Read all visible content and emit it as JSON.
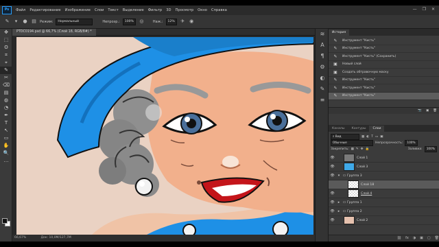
{
  "menu": {
    "logo": "Ps",
    "items": [
      "Файл",
      "Редактирование",
      "Изображение",
      "Слои",
      "Текст",
      "Выделение",
      "Фильтр",
      "3D",
      "Просмотр",
      "Окно",
      "Справка"
    ],
    "window_controls": [
      "—",
      "❐",
      "✕"
    ]
  },
  "options": {
    "mode_label": "Режим:",
    "mode_value": "Нормальный",
    "opacity_label": "Непрозр.:",
    "opacity_value": "100%",
    "pressure_label": "Наж.:",
    "pressure_value": "12%"
  },
  "tools": [
    "✥",
    "⬚",
    "ʘ",
    "⌗",
    "⌖",
    "✎",
    "✂",
    "⌫",
    "▤",
    "◍",
    "◔",
    "✒",
    "T",
    "↖",
    "▭",
    "✋",
    "🔍",
    "…"
  ],
  "document": {
    "tab_title": "PTDC0194.psd @ 66,7% (Слой 18, RGB/8#) *",
    "status_zoom": "66,67%",
    "status_doc": "Док: 10,0M/127,7M"
  },
  "iconstrip": [
    "≋",
    "A",
    "¶",
    "⚙",
    "◐",
    "✎",
    "≡"
  ],
  "history": {
    "tab": "История",
    "rows": [
      {
        "label": "Инструмент \"Кисть\"",
        "selected": false
      },
      {
        "label": "Инструмент \"Кисть\"",
        "selected": false
      },
      {
        "label": "Инструмент \"Кисть\" (Сохранить)",
        "selected": false
      },
      {
        "label": "Новый слой",
        "selected": false
      },
      {
        "label": "Создать обтравочную маску",
        "selected": false
      },
      {
        "label": "Инструмент \"Кисть\"",
        "selected": false
      },
      {
        "label": "Инструмент \"Кисть\"",
        "selected": false
      },
      {
        "label": "Инструмент \"Кисть\"",
        "selected": true
      }
    ],
    "footer_icons": [
      "📷",
      "▣",
      "🗑"
    ]
  },
  "layers": {
    "tabs": [
      "Каналы",
      "Контуры",
      "Слои"
    ],
    "active_tab": "Слои",
    "kind_label": "Вид",
    "blend_value": "Обычные",
    "opacity_label": "Непрозрачность:",
    "opacity_value": "100%",
    "lock_label": "Закрепить:",
    "fill_label": "Заливка:",
    "fill_value": "100%",
    "rows": [
      {
        "name": "Слой 1",
        "indent": 1,
        "thumb": "#7a7a7a",
        "selected": false,
        "group": false
      },
      {
        "name": "Слой 3",
        "indent": 0,
        "thumb": "#3fa9e8",
        "selected": false,
        "group": false
      },
      {
        "name": "Группа 3",
        "indent": 0,
        "thumb": "",
        "selected": false,
        "group": true
      },
      {
        "name": "Слой 18",
        "indent": 1,
        "thumb": "#e8e8e8",
        "selected": true,
        "group": false
      },
      {
        "name": "Слой 4",
        "indent": 1,
        "thumb": "#e8e8e8",
        "selected": false,
        "group": false
      },
      {
        "name": "Группа 1",
        "indent": 0,
        "thumb": "",
        "selected": false,
        "group": true
      },
      {
        "name": "Группа 2",
        "indent": 0,
        "thumb": "",
        "selected": false,
        "group": true
      },
      {
        "name": "Слой 2",
        "indent": 0,
        "thumb": "#e6c1ae",
        "selected": false,
        "group": false
      }
    ],
    "footer_icons": [
      "⛓",
      "fx",
      "◑",
      "▣",
      "▢",
      "🗑"
    ]
  },
  "colors": {
    "accent_blue": "#1e90e6",
    "skin": "#f2b08c",
    "hair_gray": "#8e8e8e",
    "background_canvas": "#ead2c3"
  }
}
